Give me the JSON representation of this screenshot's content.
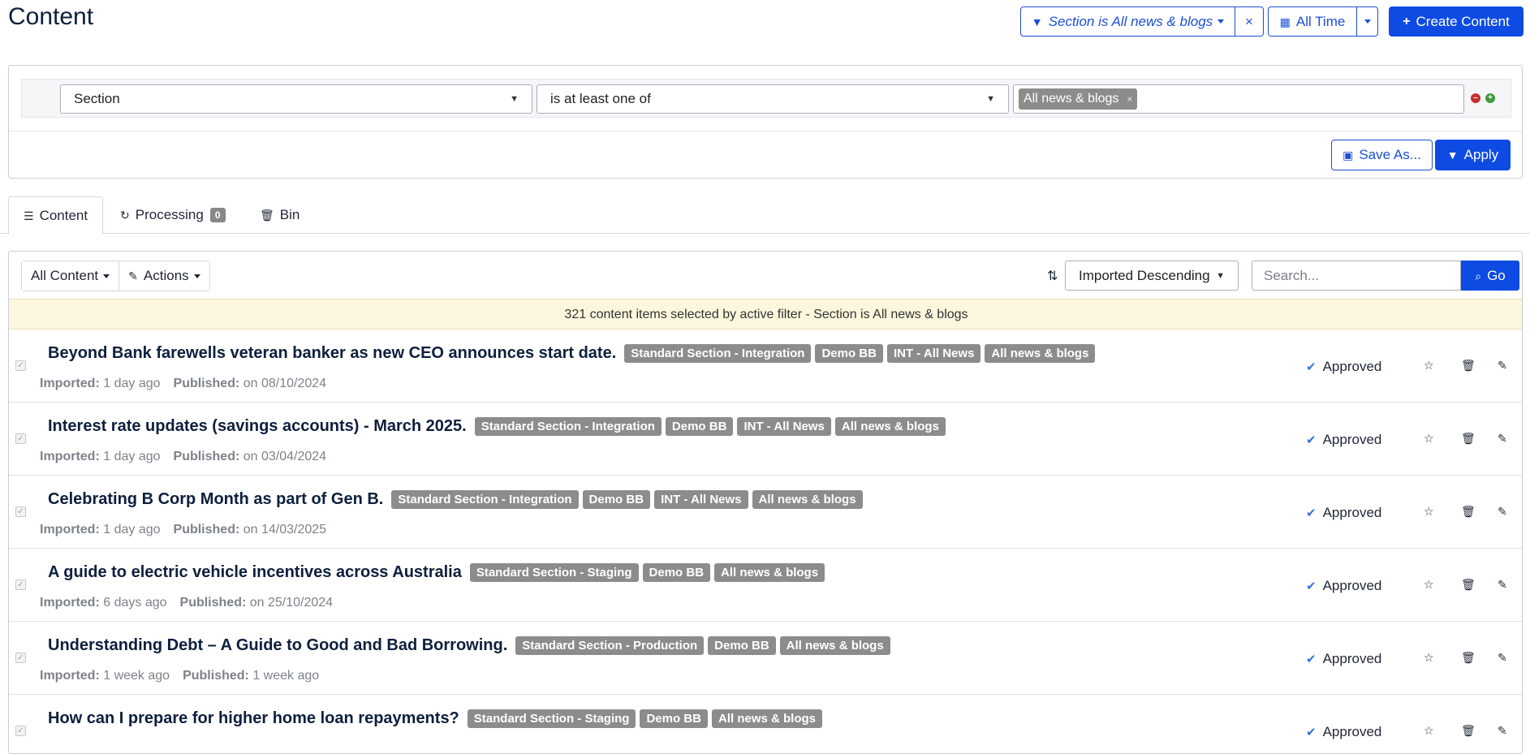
{
  "header": {
    "title": "Content",
    "filter_button_label": "Section is All news & blogs",
    "clear_filter_label": "×",
    "time_button_label": "All Time",
    "create_button_label": "Create Content"
  },
  "filter": {
    "field_value": "Section",
    "operator_value": "is at least one of",
    "chips": [
      "All news & blogs"
    ],
    "save_as_label": "Save As...",
    "apply_label": "Apply"
  },
  "tabs": {
    "content_label": "Content",
    "processing_label": "Processing",
    "processing_count": "0",
    "bin_label": "Bin"
  },
  "toolbar": {
    "all_content_label": "All Content",
    "actions_label": "Actions",
    "sort_value": "Imported Descending",
    "search_placeholder": "Search...",
    "go_label": "Go"
  },
  "notice": "321 content items selected by active filter - Section is All news & blogs",
  "labels": {
    "imported": "Imported:",
    "published": "Published:"
  },
  "items": [
    {
      "title": "Beyond Bank farewells veteran banker as new CEO announces start date.",
      "tags": [
        "Standard Section - Integration",
        "Demo BB",
        "INT - All News",
        "All news & blogs"
      ],
      "imported": "1 day ago",
      "published": "on 08/10/2024",
      "status": "Approved"
    },
    {
      "title": "Interest rate updates (savings accounts) - March 2025.",
      "tags": [
        "Standard Section - Integration",
        "Demo BB",
        "INT - All News",
        "All news & blogs"
      ],
      "imported": "1 day ago",
      "published": "on 03/04/2024",
      "status": "Approved"
    },
    {
      "title": "Celebrating B Corp Month as part of Gen B.",
      "tags": [
        "Standard Section - Integration",
        "Demo BB",
        "INT - All News",
        "All news & blogs"
      ],
      "imported": "1 day ago",
      "published": "on 14/03/2025",
      "status": "Approved"
    },
    {
      "title": "A guide to electric vehicle incentives across Australia",
      "tags": [
        "Standard Section - Staging",
        "Demo BB",
        "All news & blogs"
      ],
      "imported": "6 days ago",
      "published": "on 25/10/2024",
      "status": "Approved"
    },
    {
      "title": "Understanding Debt – A Guide to Good and Bad Borrowing.",
      "tags": [
        "Standard Section - Production",
        "Demo BB",
        "All news & blogs"
      ],
      "imported": "1 week ago",
      "published": "1 week ago",
      "status": "Approved"
    },
    {
      "title": "How can I prepare for higher home loan repayments?",
      "tags": [
        "Standard Section - Staging",
        "Demo BB",
        "All news & blogs"
      ],
      "imported": "",
      "published": "",
      "status": "Approved"
    }
  ]
}
